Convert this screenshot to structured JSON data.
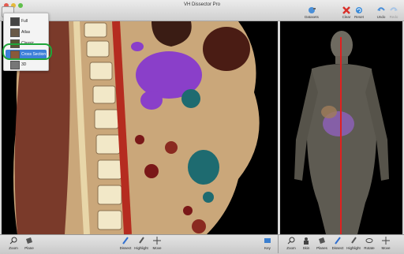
{
  "window": {
    "title": "VH Dissector Pro"
  },
  "toolbar": {
    "dataset_label": "Datasets",
    "clear_label": "Clear",
    "reset_label": "Reset",
    "undo_label": "Undo",
    "redo_label": "Redo"
  },
  "view_menu": {
    "items": [
      {
        "label": "Full"
      },
      {
        "label": "Atlas"
      },
      {
        "label": "Classic"
      },
      {
        "label": "Cross Section"
      },
      {
        "label": "3D"
      }
    ],
    "selected": "Cross Section"
  },
  "left_bar": {
    "zoom": "Zoom",
    "plane": "Plane",
    "dissect": "Dissect",
    "highlight": "Highlight",
    "move": "Move",
    "key": "Key"
  },
  "right_bar": {
    "zoom": "Zoom",
    "skin": "Skin",
    "planes": "Planes",
    "dissect": "Dissect",
    "highlight": "Highlight",
    "rotate": "Rotate",
    "move": "Move"
  },
  "colors": {
    "accent": "#3d7fd9",
    "highlight_ring": "#1fa63a",
    "organ_highlight": "#8a3fc9",
    "plane_line": "#e02020"
  }
}
